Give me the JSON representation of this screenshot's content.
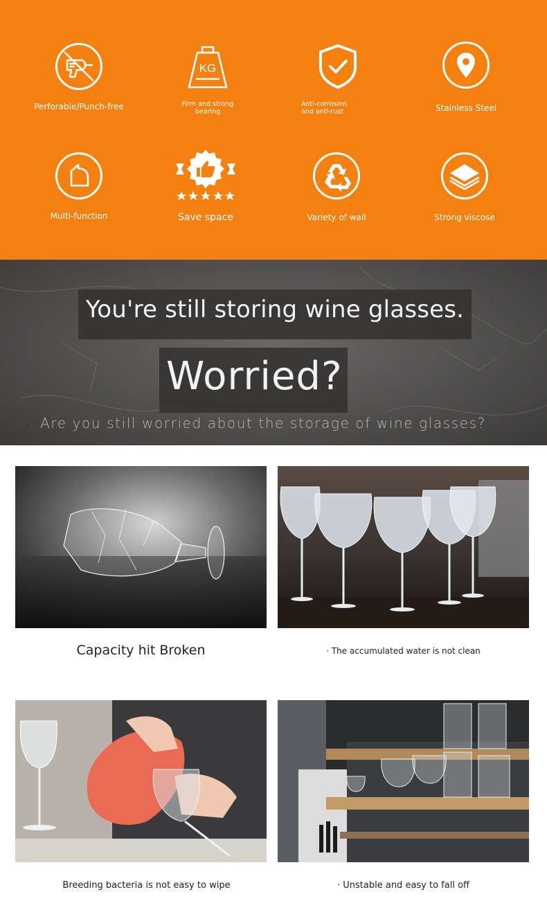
{
  "features": [
    {
      "label": "Perforable/Punch-free",
      "icon": "drill-crossed-icon"
    },
    {
      "label": "Firm and strong bearing",
      "icon": "kg-weight-icon"
    },
    {
      "label": "Anti-corrosion and anti-rust",
      "icon": "shield-check-icon"
    },
    {
      "label": "Stainless Steel",
      "icon": "location-pin-icon"
    },
    {
      "label": "Multi-function",
      "icon": "return-arrow-icon"
    },
    {
      "label": "Save space",
      "icon": "thumbs-up-badge-icon"
    },
    {
      "label": "Variety of wall",
      "icon": "recycle-icon"
    },
    {
      "label": "Strong viscose",
      "icon": "layers-icon"
    }
  ],
  "features_kg": "KG",
  "banner": {
    "headline": "You're still storing wine glasses.",
    "worried": "Worried?",
    "subline": "Are you still worried about the storage of wine glasses?"
  },
  "problems": [
    {
      "caption": "Capacity hit Broken"
    },
    {
      "caption": "· The accumulated water is not clean"
    },
    {
      "caption": "Breeding bacteria is not easy to wipe"
    },
    {
      "caption": "· Unstable and easy to fall off"
    }
  ],
  "colors": {
    "orange": "#f3800f",
    "banner_dark": "#4a4948",
    "white": "#ffffff"
  }
}
